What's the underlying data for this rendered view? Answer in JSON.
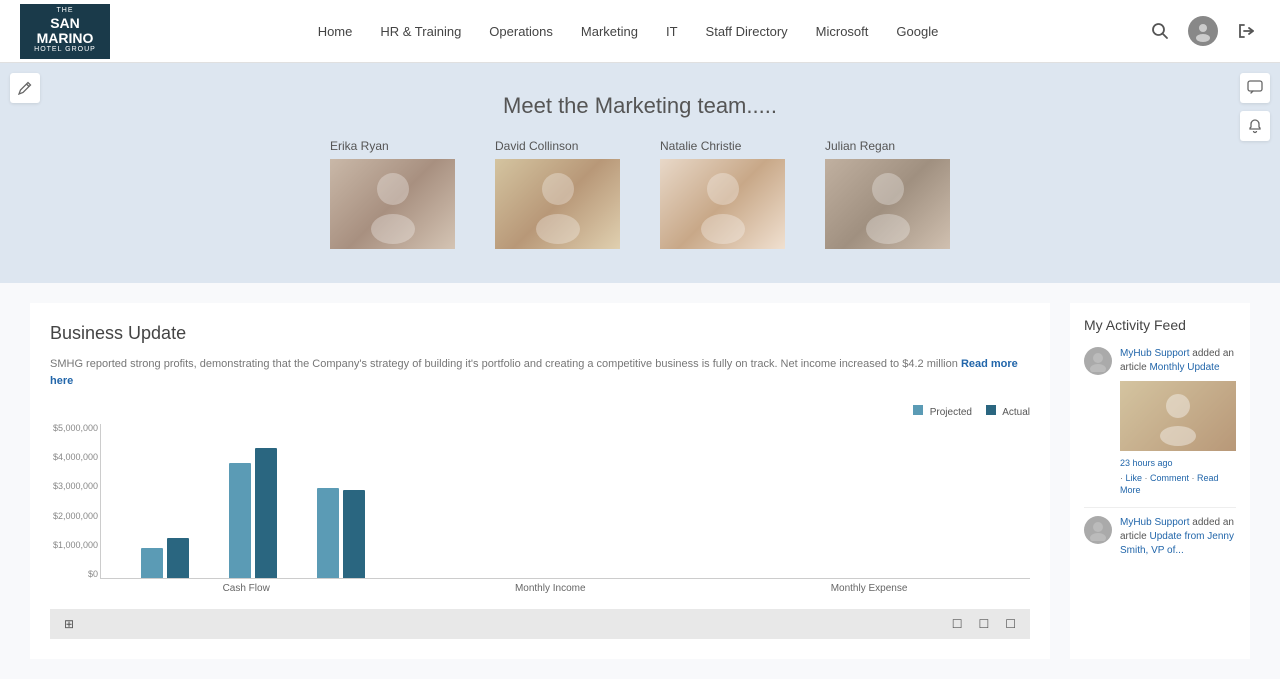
{
  "logo": {
    "the": "THE",
    "name": "SAN MARINO",
    "group": "HOTEL GROUP"
  },
  "nav": {
    "items": [
      {
        "label": "Home",
        "id": "home"
      },
      {
        "label": "HR & Training",
        "id": "hr-training"
      },
      {
        "label": "Operations",
        "id": "operations"
      },
      {
        "label": "Marketing",
        "id": "marketing"
      },
      {
        "label": "IT",
        "id": "it"
      },
      {
        "label": "Staff Directory",
        "id": "staff-directory"
      },
      {
        "label": "Microsoft",
        "id": "microsoft"
      },
      {
        "label": "Google",
        "id": "google"
      }
    ]
  },
  "hero": {
    "title": "Meet the Marketing team.....",
    "team": [
      {
        "name": "Erika Ryan",
        "photo_class": "photo-1"
      },
      {
        "name": "David Collinson",
        "photo_class": "photo-2"
      },
      {
        "name": "Natalie Christie",
        "photo_class": "photo-3"
      },
      {
        "name": "Julian Regan",
        "photo_class": "photo-4"
      }
    ]
  },
  "business_update": {
    "title": "Business Update",
    "text": "SMHG reported strong profits, demonstrating that the Company's strategy of building it's portfolio and creating a competitive business is fully on track. Net income increased to $4.2 million",
    "read_more": "Read more here",
    "chart": {
      "legend": [
        {
          "label": "Projected",
          "color": "#5b9bb5"
        },
        {
          "label": "Actual",
          "color": "#2a6680"
        }
      ],
      "y_labels": [
        "$5,000,000",
        "$4,000,000",
        "$3,000,000",
        "$2,000,000",
        "$1,000,000",
        "$0"
      ],
      "groups": [
        {
          "label": "Cash Flow",
          "projected_height": 30,
          "actual_height": 40
        },
        {
          "label": "Monthly Income",
          "projected_height": 115,
          "actual_height": 130
        },
        {
          "label": "Monthly Expense",
          "projected_height": 90,
          "actual_height": 88
        }
      ]
    }
  },
  "activity_feed": {
    "title": "My Activity Feed",
    "items": [
      {
        "author": "MyHub Support",
        "action": "added an article",
        "link_text": "Monthly Update",
        "time": "23 hours ago",
        "actions": [
          "Like",
          "Comment"
        ],
        "read_more": "Read More",
        "has_image": true
      },
      {
        "author": "MyHub Support",
        "action": "added an article",
        "link_text": "Update from Jenny Smith, VP of...",
        "time": "",
        "actions": [],
        "read_more": "",
        "has_image": false
      }
    ]
  },
  "toolbar": {
    "excel_icon": "⊞"
  }
}
